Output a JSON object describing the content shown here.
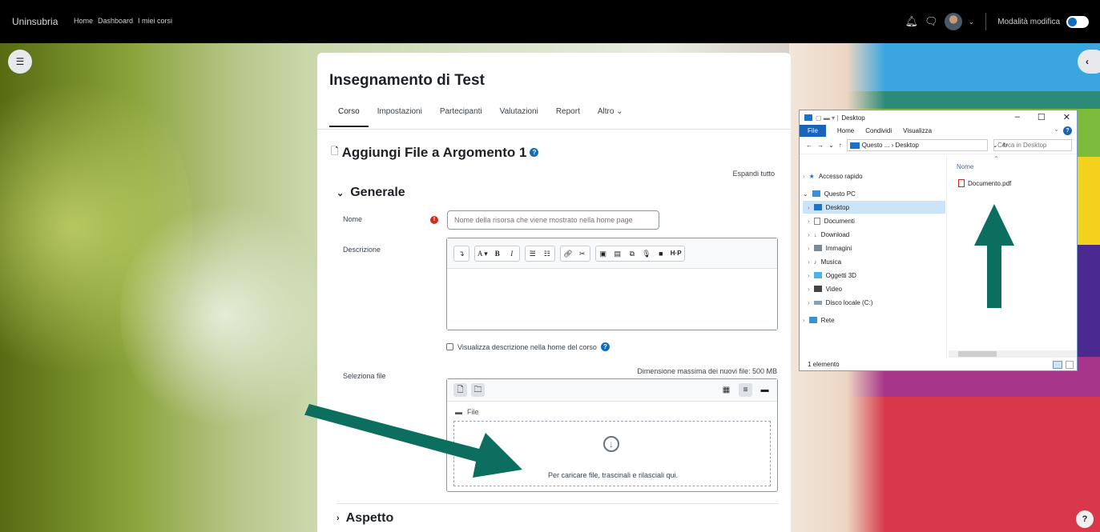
{
  "navbar": {
    "brand": "Uninsubria",
    "links": [
      "Home",
      "Dashboard",
      "I miei corsi"
    ],
    "edit_mode_label": "Modalità modifica"
  },
  "course": {
    "title": "Insegnamento di Test",
    "tabs": [
      "Corso",
      "Impostazioni",
      "Partecipanti",
      "Valutazioni",
      "Report",
      "Altro ⌄"
    ],
    "active_tab": "Corso"
  },
  "form": {
    "heading": "Aggiungi File a Argomento 1",
    "expand_all": "Espandi tutto",
    "section_generale": "Generale",
    "name_label": "Nome",
    "name_placeholder": "Nome della risorsa che viene mostrato nella home page",
    "description_label": "Descrizione",
    "show_description": "Visualizza descrizione nella home del corso",
    "select_file_label": "Seleziona file",
    "max_size": "Dimensione massima dei nuovi file: 500 MB",
    "folder_path": "File",
    "drop_text": "Per caricare file, trascinali e rilasciali qui.",
    "section_aspetto": "Aspetto"
  },
  "explorer": {
    "title": "Desktop",
    "ribbon": [
      "File",
      "Home",
      "Condividi",
      "Visualizza"
    ],
    "address": "Questo ... › Desktop",
    "search_placeholder": "Cerca in Desktop",
    "column_name": "Nome",
    "nav": [
      {
        "label": "Accesso rapido",
        "icon": "star-icon"
      },
      {
        "label": "Questo PC",
        "icon": "computer-icon"
      },
      {
        "label": "Desktop",
        "icon": "desktop-folder-icon"
      },
      {
        "label": "Documenti",
        "icon": "documents-icon"
      },
      {
        "label": "Download",
        "icon": "download-icon"
      },
      {
        "label": "Immagini",
        "icon": "pictures-icon"
      },
      {
        "label": "Musica",
        "icon": "music-icon"
      },
      {
        "label": "Oggetti 3D",
        "icon": "3d-objects-icon"
      },
      {
        "label": "Video",
        "icon": "video-icon"
      },
      {
        "label": "Disco locale (C:)",
        "icon": "drive-icon"
      },
      {
        "label": "Rete",
        "icon": "network-icon"
      }
    ],
    "files": [
      {
        "name": "Documento.pdf",
        "icon": "pdf-icon"
      }
    ],
    "status": "1 elemento"
  },
  "colors": {
    "primary": "#0f6cbf",
    "arrow": "#0b6e5e",
    "required": "#ca3120"
  }
}
